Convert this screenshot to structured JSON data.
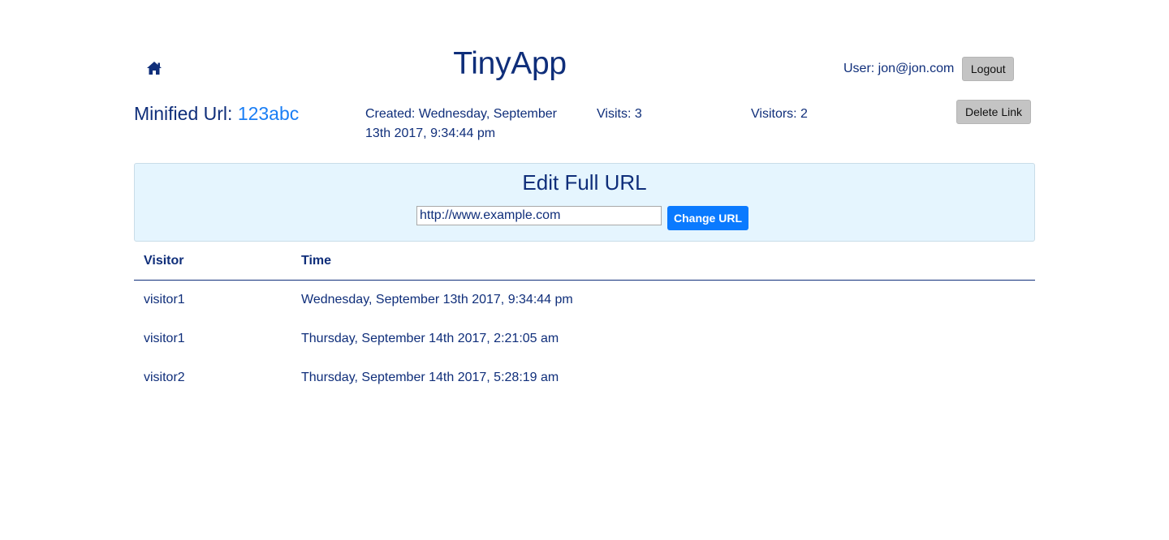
{
  "header": {
    "home_icon": "home-icon",
    "app_title": "TinyApp",
    "user_label": "User: jon@jon.com",
    "logout_label": "Logout"
  },
  "info": {
    "minified_label": "Minified Url:",
    "minified_code": "123abc",
    "created": "Created: Wednesday, September 13th 2017, 9:34:44 pm",
    "visits": "Visits: 3",
    "visitors": "Visitors: 2",
    "delete_label": "Delete Link"
  },
  "edit": {
    "title": "Edit Full URL",
    "url_value": "http://www.example.com",
    "submit_label": "Change URL"
  },
  "table": {
    "headers": [
      "Visitor",
      "Time"
    ],
    "rows": [
      [
        "visitor1",
        "Wednesday, September 13th 2017, 9:34:44 pm"
      ],
      [
        "visitor1",
        "Thursday, September 14th 2017, 2:21:05 am"
      ],
      [
        "visitor2",
        "Thursday, September 14th 2017, 5:28:19 am"
      ]
    ]
  },
  "colors": {
    "text": "#0f2e7a",
    "link": "#1a7ef5",
    "primary_button": "#0a7aff",
    "panel_background": "#e5f5fe",
    "grey_button": "#c4c4c4"
  }
}
